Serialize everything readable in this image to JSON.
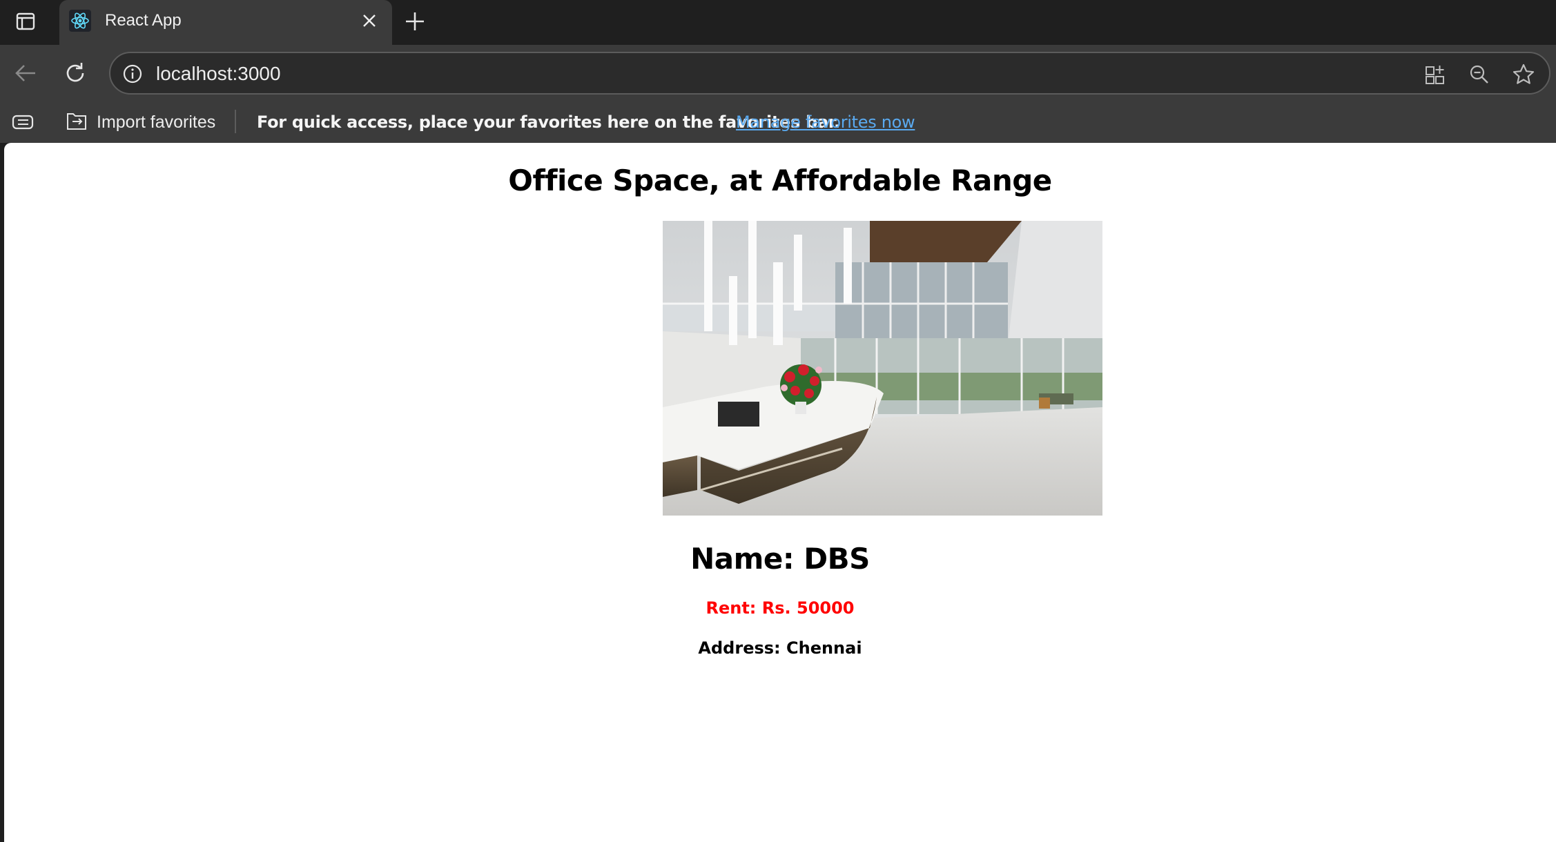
{
  "browser": {
    "tab": {
      "title": "React App",
      "favicon": "react-atom-icon"
    },
    "address": {
      "url": "localhost:3000"
    },
    "favorites_bar": {
      "import_label": "Import favorites",
      "message": "For quick access, place your favorites here on the favorites bar.",
      "link": "Manage favorites now"
    }
  },
  "page": {
    "title": "Office Space, at Affordable Range",
    "office": {
      "name": "Name: DBS",
      "rent": "Rent: Rs. 50000",
      "address": "Address: Chennai"
    }
  },
  "colors": {
    "rent_text": "#ff0000",
    "link": "#5aaaf0",
    "chrome_dark": "#1f1f1f",
    "chrome": "#3b3b3b"
  }
}
